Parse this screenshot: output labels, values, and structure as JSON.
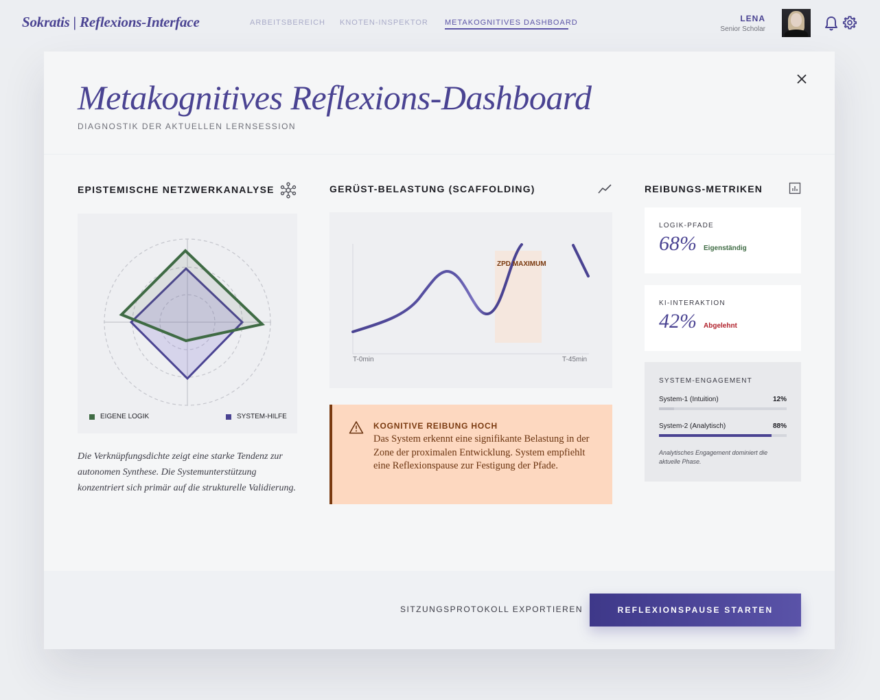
{
  "app": {
    "brand": "Sokratis | Reflexions-Interface",
    "nav": [
      {
        "label": "ARBEITSBEREICH",
        "active": false
      },
      {
        "label": "KNOTEN-INSPEKTOR",
        "active": false
      },
      {
        "label": "METAKOGNITIVES DASHBOARD",
        "active": true
      }
    ],
    "user": {
      "name": "LENA",
      "role": "Senior Scholar"
    }
  },
  "modal": {
    "title": "Metakognitives Reflexions-Dashboard",
    "subtitle": "DIAGNOSTIK DER AKTUELLEN LERNSESSION",
    "network": {
      "title": "EPISTEMISCHE NETZWERKANALYSE",
      "legend": [
        {
          "label": "EIGENE LOGIK",
          "color": "#3f6b44"
        },
        {
          "label": "SYSTEM-HILFE",
          "color": "#4a4392"
        }
      ],
      "description": "Die Verknüpfungsdichte zeigt eine starke Tendenz zur autonomen Synthese. Die Systemunterstützung konzentriert sich primär auf die strukturelle Validierung."
    },
    "scaffolding": {
      "title": "GERÜST-BELASTUNG (SCAFFOLDING)",
      "zone_label": "ZPD MAXIMUM",
      "x_start": "T-0min",
      "x_end": "T-45min"
    },
    "alert": {
      "title": "KOGNITIVE REIBUNG HOCH",
      "text": "Das System erkennt eine signifikante Belastung in der Zone der proximalen Entwicklung. System empfiehlt eine Reflexionspause zur Festigung der Pfade."
    },
    "metrics": {
      "title": "REIBUNGS-METRIKEN",
      "cards": [
        {
          "label": "LOGIK-PFADE",
          "value": "68%",
          "note": "Eigenständig",
          "note_color": "#3f6b44"
        },
        {
          "label": "KI-INTERAKTION",
          "value": "42%",
          "note": "Abgelehnt",
          "note_color": "#b0202a"
        }
      ],
      "engagement": {
        "title": "SYSTEM-ENGAGEMENT",
        "rows": [
          {
            "label": "System-1 (Intuition)",
            "value": "12%",
            "fraction": 0.12,
            "color": "#c4c6ce"
          },
          {
            "label": "System-2 (Analytisch)",
            "value": "88%",
            "fraction": 0.88,
            "color": "#4a4392"
          }
        ],
        "note": "Analytisches Engagement dominiert die aktuelle Phase."
      }
    },
    "footer": {
      "export_label": "SITZUNGSPROTOKOLL EXPORTIEREN",
      "primary_label": "REFLEXIONSPAUSE STARTEN"
    }
  }
}
